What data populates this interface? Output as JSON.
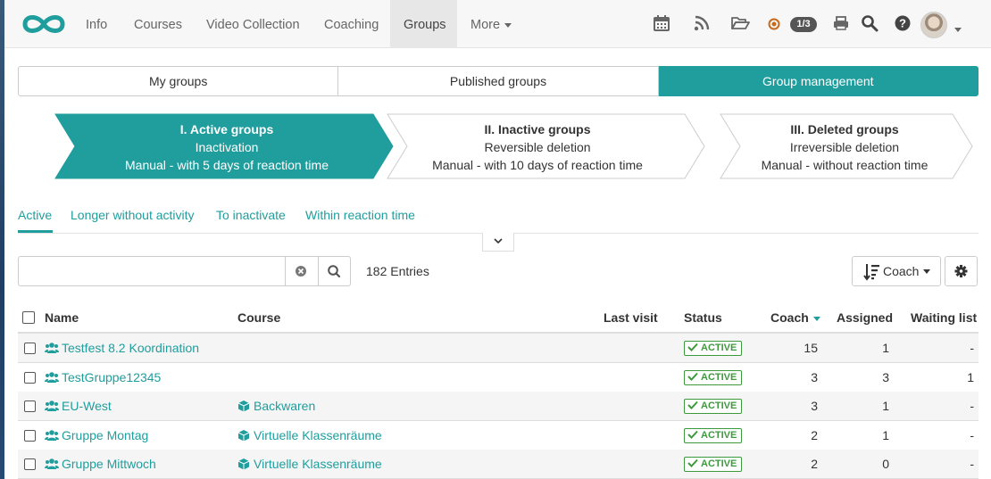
{
  "nav": {
    "items": [
      "Info",
      "Courses",
      "Video Collection",
      "Coaching",
      "Groups",
      "More"
    ],
    "active": "Groups",
    "counter": "1/3"
  },
  "segments": [
    "My groups",
    "Published groups",
    "Group management"
  ],
  "process": [
    {
      "title": "I. Active groups",
      "line1": "Inactivation",
      "line2": "Manual - with 5 days of reaction time"
    },
    {
      "title": "II. Inactive groups",
      "line1": "Reversible deletion",
      "line2": "Manual - with 10 days of reaction time"
    },
    {
      "title": "III. Deleted groups",
      "line1": "Irreversible deletion",
      "line2": "Manual - without reaction time"
    }
  ],
  "tabs": [
    "Active",
    "Longer without activity",
    "To inactivate",
    "Within reaction time"
  ],
  "search": {
    "placeholder": "",
    "entries": "182 Entries"
  },
  "sort": {
    "label": "Coach"
  },
  "table": {
    "headers": [
      "Name",
      "Course",
      "Last visit",
      "Status",
      "Coach",
      "Assigned",
      "Waiting list"
    ],
    "rows": [
      {
        "name": "Testfest 8.2 Koordination",
        "course": "",
        "status": "ACTIVE",
        "coach": "15",
        "assigned": "1",
        "waiting": "-"
      },
      {
        "name": "TestGruppe12345",
        "course": "",
        "status": "ACTIVE",
        "coach": "3",
        "assigned": "3",
        "waiting": "1"
      },
      {
        "name": "EU-West",
        "course": "Backwaren",
        "status": "ACTIVE",
        "coach": "3",
        "assigned": "1",
        "waiting": "-"
      },
      {
        "name": "Gruppe Montag",
        "course": "Virtuelle Klassenräume",
        "status": "ACTIVE",
        "coach": "2",
        "assigned": "1",
        "waiting": "-"
      },
      {
        "name": "Gruppe Mittwoch",
        "course": "Virtuelle Klassenräume",
        "status": "ACTIVE",
        "coach": "2",
        "assigned": "0",
        "waiting": "-"
      }
    ]
  },
  "colors": {
    "accent": "#209d9d",
    "status_green": "#3c9a3c"
  }
}
